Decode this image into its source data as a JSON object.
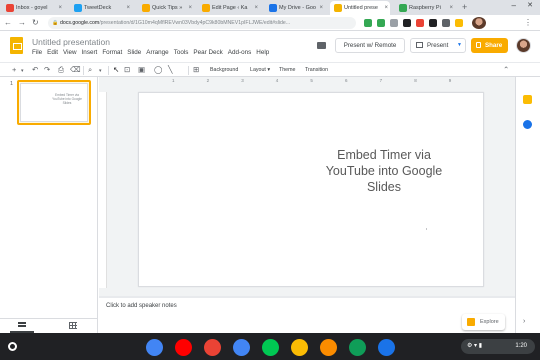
{
  "browser": {
    "tabs": [
      {
        "title": "Inbox - goyel",
        "favicon_color": "#ea4335",
        "active": false
      },
      {
        "title": "TweetDeck",
        "favicon_color": "#1da1f2",
        "active": false
      },
      {
        "title": "Quick Tips »",
        "favicon_color": "#f9ab00",
        "active": false
      },
      {
        "title": "Edit Page ‹ Ka",
        "favicon_color": "#f9ab00",
        "active": false
      },
      {
        "title": "My Drive - Goo",
        "favicon_color": "#1a73e8",
        "active": false
      },
      {
        "title": "Untitled prese",
        "favicon_color": "#f4b400",
        "active": true
      },
      {
        "title": "Raspberry Pi",
        "favicon_color": "#34a853",
        "active": false
      }
    ],
    "tab_close": "×",
    "url_host": "docs.google.com",
    "url_path": "/presentation/d/1G10m4qMflREVwn03Vbdy4pC9k80bMNEV1pIFLJWE/edit#slide...",
    "extension_colors": [
      "#34a853",
      "#34a853",
      "#9aa0a6",
      "#202124",
      "#ea4335",
      "#202124",
      "#5f6368",
      "#fbbc04"
    ]
  },
  "docs": {
    "title": "Untitled presentation",
    "menu": [
      "File",
      "Edit",
      "View",
      "Insert",
      "Format",
      "Slide",
      "Arrange",
      "Tools",
      "Pear Deck",
      "Add-ons",
      "Help"
    ],
    "present_remote_label": "Present w/ Remote",
    "present_label": "Present",
    "share_label": "Share"
  },
  "toolbar": {
    "background_label": "Background",
    "layout_label": "Layout",
    "theme_label": "Theme",
    "transition_label": "Transition"
  },
  "filmstrip": {
    "slide_number": "1",
    "thumb_text": "Embed Timer via YouTube into Google Slides"
  },
  "slide": {
    "title_text": "Embed Timer via YouTube into Google Slides",
    "cursor_char": "ı"
  },
  "ruler": {
    "ticks": [
      "1",
      "2",
      "3",
      "4",
      "5",
      "6",
      "7",
      "8",
      "9"
    ]
  },
  "notes": {
    "placeholder": "Click to add speaker notes"
  },
  "explore": {
    "label": "Explore"
  },
  "system": {
    "time": "1:20",
    "shelf_apps": [
      {
        "name": "chrome-app-icon",
        "color": "#4285f4"
      },
      {
        "name": "youtube-app-icon",
        "color": "#ff0000"
      },
      {
        "name": "gmail-app-icon",
        "color": "#ea4335"
      },
      {
        "name": "docs-app-icon",
        "color": "#4285f4"
      },
      {
        "name": "play-store-app-icon",
        "color": "#00c853"
      },
      {
        "name": "keep-app-icon",
        "color": "#fbbc04"
      },
      {
        "name": "photos-app-icon",
        "color": "#fb8c00"
      },
      {
        "name": "classroom-app-icon",
        "color": "#0f9d58"
      },
      {
        "name": "duo-app-icon",
        "color": "#1a73e8"
      }
    ]
  },
  "colors": {
    "accent": "#f9ab00",
    "share_button": "#f9ab00",
    "slide_text": "#595959"
  }
}
